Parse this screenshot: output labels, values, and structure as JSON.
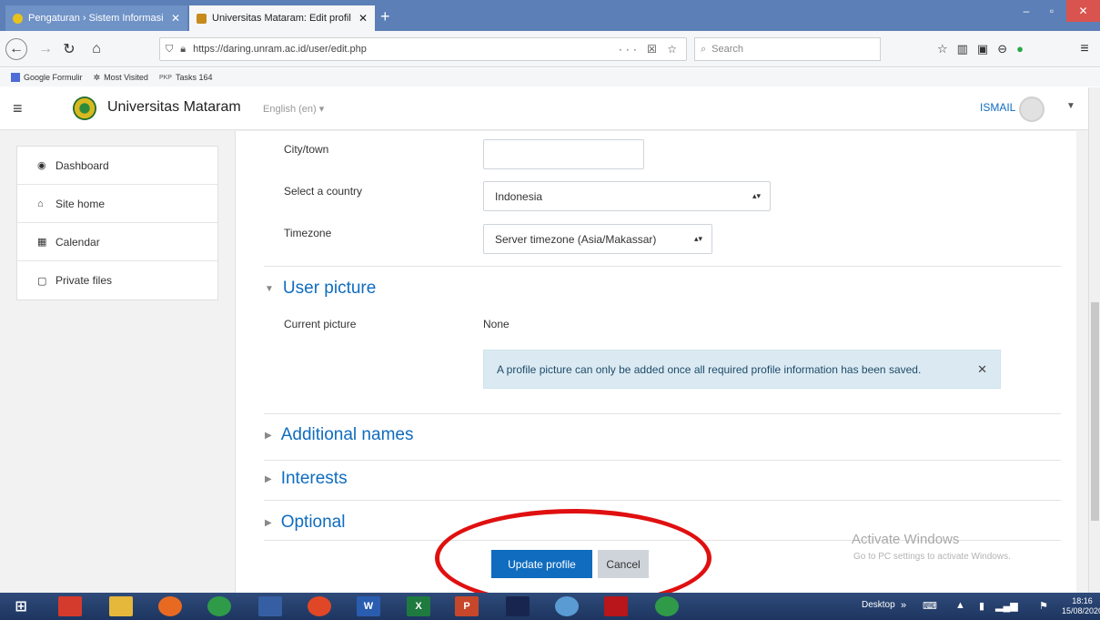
{
  "browser": {
    "tabs": [
      {
        "title": "Pengaturan › Sistem Informasi"
      },
      {
        "title": "Universitas Mataram: Edit profil"
      }
    ],
    "new_tab": "+",
    "url": "https://daring.unram.ac.id/user/edit.php",
    "url_actions": "··· ☒ ☆",
    "search_placeholder": "Search",
    "bookmarks": [
      "Google Formulir",
      "Most Visited",
      "Tasks 164"
    ],
    "bookmark_prefix": "PKP"
  },
  "header": {
    "site_name": "Universitas Mataram",
    "language": "English (en) ▾",
    "user_name": "ISMAIL"
  },
  "sidebar": {
    "items": [
      {
        "label": "Dashboard",
        "icon": "dashboard-icon",
        "glyph": "◉"
      },
      {
        "label": "Site home",
        "icon": "home-icon",
        "glyph": "⌂"
      },
      {
        "label": "Calendar",
        "icon": "calendar-icon",
        "glyph": "▦"
      },
      {
        "label": "Private files",
        "icon": "file-icon",
        "glyph": "▢"
      }
    ]
  },
  "form": {
    "city_label": "City/town",
    "city_value": "",
    "country_label": "Select a country",
    "country_value": "Indonesia",
    "timezone_label": "Timezone",
    "timezone_value": "Server timezone (Asia/Makassar)",
    "user_picture_title": "User picture",
    "current_picture_label": "Current picture",
    "current_picture_value": "None",
    "alert_text": "A profile picture can only be added once all required profile information has been saved.",
    "additional_names": "Additional names",
    "interests": "Interests",
    "optional": "Optional",
    "update_button": "Update profile",
    "cancel_button": "Cancel"
  },
  "watermark": {
    "line1": "Activate Windows",
    "line2": "Go to PC settings to activate Windows."
  },
  "taskbar": {
    "desktop_label": "Desktop",
    "time": "18:16",
    "date": "15/08/2020"
  },
  "colors": {
    "moodle_blue": "#0f6cbf",
    "annotation_red": "#e01010",
    "alert_bg": "#dbeaf2"
  }
}
